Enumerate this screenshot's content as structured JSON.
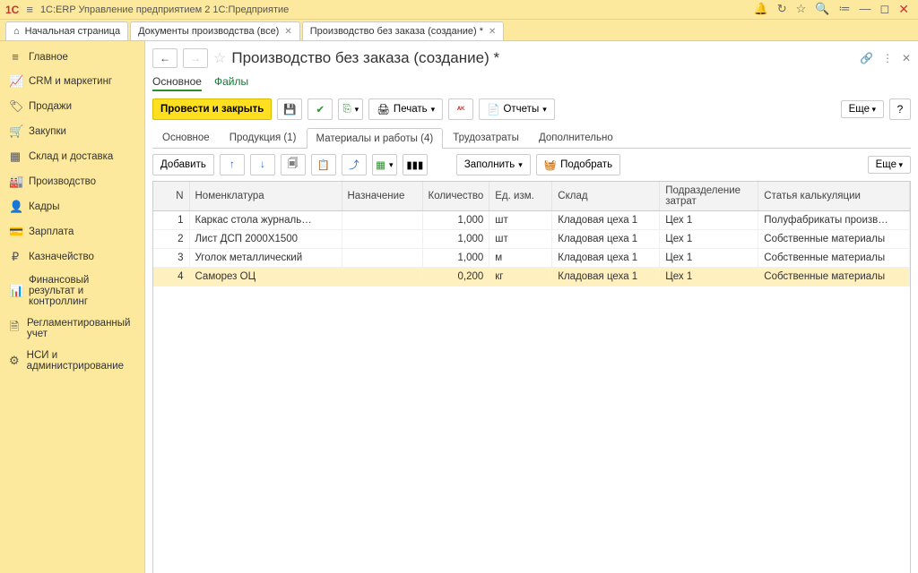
{
  "app_title": "1С:ERP Управление предприятием 2 1С:Предприятие",
  "titlebar_tabs": [
    {
      "label": "Начальная страница",
      "closable": false,
      "home": true
    },
    {
      "label": "Документы производства (все)",
      "closable": true
    },
    {
      "label": "Производство без заказа (создание) *",
      "closable": true
    }
  ],
  "sidebar": [
    {
      "icon": "≡",
      "label": "Главное"
    },
    {
      "icon": "📈",
      "label": "CRM и маркетинг"
    },
    {
      "icon": "💰",
      "label": "Продажи"
    },
    {
      "icon": "🛒",
      "label": "Закупки"
    },
    {
      "icon": "▦",
      "label": "Склад и доставка"
    },
    {
      "icon": "🏭",
      "label": "Производство"
    },
    {
      "icon": "👤",
      "label": "Кадры"
    },
    {
      "icon": "💳",
      "label": "Зарплата"
    },
    {
      "icon": "₽",
      "label": "Казначейство"
    },
    {
      "icon": "📊",
      "label": "Финансовый результат и контроллинг"
    },
    {
      "icon": "🗎",
      "label": "Регламентированный учет"
    },
    {
      "icon": "⚙",
      "label": "НСИ и администрирование"
    }
  ],
  "page_title": "Производство без заказа (создание) *",
  "subtabs": {
    "main": "Основное",
    "files": "Файлы"
  },
  "toolbar1": {
    "post_close": "Провести и закрыть",
    "print": "Печать",
    "reports": "Отчеты",
    "more": "Еще"
  },
  "doctabs": [
    {
      "label": "Основное"
    },
    {
      "label": "Продукция (1)"
    },
    {
      "label": "Материалы и работы (4)",
      "active": true
    },
    {
      "label": "Трудозатраты"
    },
    {
      "label": "Дополнительно"
    }
  ],
  "toolbar2": {
    "add": "Добавить",
    "fill": "Заполнить",
    "pick": "Подобрать",
    "more": "Еще"
  },
  "columns": {
    "n": "N",
    "nomen": "Номенклатура",
    "nazn": "Назначение",
    "qty": "Количество",
    "uom": "Ед. изм.",
    "store": "Склад",
    "dept": "Подразделение затрат",
    "calc": "Статья калькуляции"
  },
  "rows": [
    {
      "n": "1",
      "nomen": "Каркас стола журналь…",
      "nazn": "",
      "qty": "1,000",
      "uom": "шт",
      "store": "Кладовая цеха 1",
      "dept": "Цех 1",
      "calc": "Полуфабрикаты произв…"
    },
    {
      "n": "2",
      "nomen": "Лист ДСП 2000Х1500",
      "nazn": "",
      "qty": "1,000",
      "uom": "шт",
      "store": "Кладовая цеха 1",
      "dept": "Цех 1",
      "calc": "Собственные материалы"
    },
    {
      "n": "3",
      "nomen": "Уголок металлический",
      "nazn": "",
      "qty": "1,000",
      "uom": "м",
      "store": "Кладовая цеха 1",
      "dept": "Цех 1",
      "calc": "Собственные материалы"
    },
    {
      "n": "4",
      "nomen": "Саморез ОЦ",
      "nazn": "",
      "qty": "0,200",
      "uom": "кг",
      "store": "Кладовая цеха 1",
      "dept": "Цех 1",
      "calc": "Собственные материалы"
    }
  ]
}
